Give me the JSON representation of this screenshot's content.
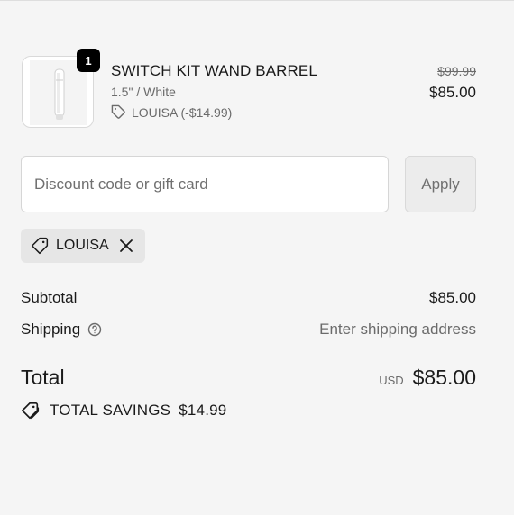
{
  "cart": {
    "line_item": {
      "quantity": "1",
      "title": "SWITCH KIT WAND BARREL",
      "variant": "1.5\" / White",
      "discount": "LOUISA (-$14.99)",
      "original_price": "$99.99",
      "final_price": "$85.00"
    }
  },
  "discount_form": {
    "placeholder": "Discount code or gift card",
    "value": "",
    "apply_label": "Apply"
  },
  "applied_code": {
    "label": "LOUISA"
  },
  "summary": {
    "subtotal_label": "Subtotal",
    "subtotal_value": "$85.00",
    "shipping_label": "Shipping",
    "shipping_value": "Enter shipping address",
    "total_label": "Total",
    "currency": "USD",
    "total_value": "$85.00",
    "savings_label": "TOTAL SAVINGS",
    "savings_value": "$14.99"
  },
  "icons": {
    "tag": "tag-icon",
    "close": "close-icon",
    "help": "question-circle-icon",
    "savings": "double-tag-icon"
  }
}
